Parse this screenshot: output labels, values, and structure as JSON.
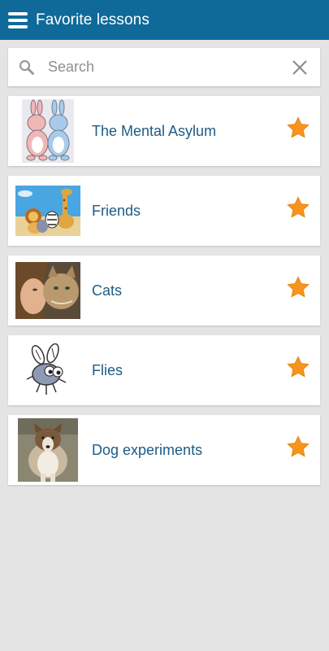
{
  "header": {
    "title": "Favorite lessons",
    "menu_icon": "hamburger-menu-icon"
  },
  "search": {
    "placeholder": "Search",
    "value": "",
    "clear_icon": "close-icon"
  },
  "colors": {
    "header_bg": "#0f6a99",
    "title_text": "#1d5b86",
    "star": "#f7941d",
    "background": "#e4e4e4"
  },
  "lessons": [
    {
      "title": "The Mental Asylum",
      "favorite": true,
      "thumbnail": "two-bunnies-image"
    },
    {
      "title": "Friends",
      "favorite": true,
      "thumbnail": "zoo-animals-image"
    },
    {
      "title": "Cats",
      "favorite": true,
      "thumbnail": "girl-with-cat-image"
    },
    {
      "title": "Flies",
      "favorite": true,
      "thumbnail": "cartoon-fly-image"
    },
    {
      "title": "Dog experiments",
      "favorite": true,
      "thumbnail": "collie-dog-image"
    }
  ]
}
